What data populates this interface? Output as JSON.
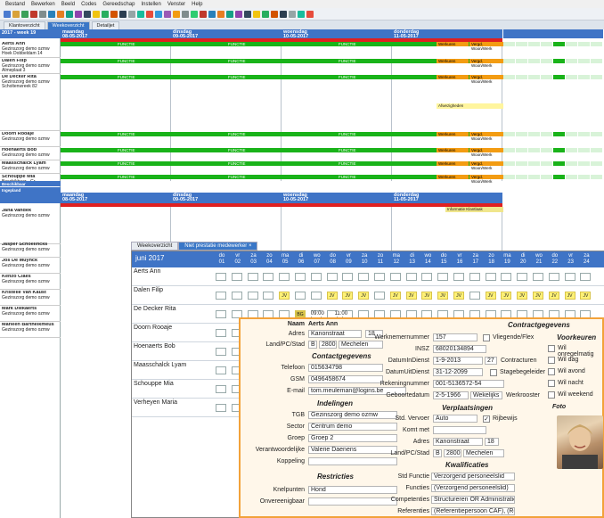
{
  "menu": [
    "Bestand",
    "Bewerken",
    "Beeld",
    "Codes",
    "Gereedschap",
    "Instellen",
    "Venster",
    "Help"
  ],
  "tabs": [
    "Klantoverzicht",
    "Weekoverzicht",
    "Detailjet"
  ],
  "week_label": "2017 - week 19",
  "days": [
    {
      "name": "maandag",
      "date": "08-05-2017"
    },
    {
      "name": "dinsdag",
      "date": "09-05-2017"
    },
    {
      "name": "woensdag",
      "date": "10-05-2017"
    },
    {
      "name": "donderdag",
      "date": "11-05-2017"
    }
  ],
  "people_top": [
    {
      "name": "Aerts Ann",
      "sub": "Gezinszorg demo ozmw",
      "extra": "Hoek Dobbeldam   14"
    },
    {
      "name": "Dalen Filip",
      "sub": "Gezinszorg demo ozmw",
      "extra": "Almeplaat   3"
    },
    {
      "name": "De Decker Rita",
      "sub": "Gezinszorg demo ozmw",
      "extra": "Scholtenwreek   82"
    }
  ],
  "people_mid": [
    {
      "name": "Doorn Rooaje",
      "sub": "Gezinszorg demo ozmw"
    },
    {
      "name": "Hoenaerts Bob",
      "sub": "Gezinszorg demo ozmw"
    },
    {
      "name": "Maasschalck Lyam",
      "sub": "Gezinszorg demo ozmw"
    },
    {
      "name": "Schouppe Mia",
      "sub": "Beschikbaar - Gr"
    }
  ],
  "people_bottom": [
    {
      "name": "Jana vandek",
      "sub": "Gezinszorg demo ozmw"
    },
    {
      "name": "Jasper Schoelincks",
      "sub": "Gezinszorg demo ozmw"
    },
    {
      "name": "Jos De Muynck",
      "sub": "Gezinszorg demo ozmw"
    },
    {
      "name": "Kenzo Claes",
      "sub": "Gezinszorg demo ozmw"
    },
    {
      "name": "Kristelle Van Kaust",
      "sub": "Gezinszorg demo ozmw"
    },
    {
      "name": "Mark Diekaerts",
      "sub": "Gezinszorg demo ozmw"
    },
    {
      "name": "Marleen Barthelkmeus",
      "sub": "Gezinszorg demo ozmw"
    }
  ],
  "popup": {
    "tabs": [
      "Weekoverzicht",
      "Niet prestatie medewerker"
    ],
    "close": "×",
    "month": "juni 2017",
    "days": [
      {
        "d": "do",
        "n": "01"
      },
      {
        "d": "vr",
        "n": "02"
      },
      {
        "d": "za",
        "n": "03"
      },
      {
        "d": "zo",
        "n": "04"
      },
      {
        "d": "ma",
        "n": "05"
      },
      {
        "d": "di",
        "n": "06"
      },
      {
        "d": "wo",
        "n": "07"
      },
      {
        "d": "do",
        "n": "08"
      },
      {
        "d": "vr",
        "n": "09"
      },
      {
        "d": "za",
        "n": "10"
      },
      {
        "d": "zo",
        "n": "11"
      },
      {
        "d": "ma",
        "n": "12"
      },
      {
        "d": "di",
        "n": "13"
      },
      {
        "d": "wo",
        "n": "14"
      },
      {
        "d": "do",
        "n": "15"
      },
      {
        "d": "vr",
        "n": "16"
      },
      {
        "d": "za",
        "n": "17"
      },
      {
        "d": "zo",
        "n": "18"
      },
      {
        "d": "ma",
        "n": "19"
      },
      {
        "d": "di",
        "n": "20"
      },
      {
        "d": "wo",
        "n": "21"
      },
      {
        "d": "do",
        "n": "22"
      },
      {
        "d": "vr",
        "n": "23"
      },
      {
        "d": "za",
        "n": "24"
      }
    ],
    "rows": [
      "Aerts Ann",
      "Dalen Filip",
      "De Decker Rita",
      "Doorn Rooaje",
      "Hoenaerts Bob",
      "Maasschalck Lyam",
      "Schouppe Mia",
      "Verheyen Maria"
    ],
    "jv": "JV",
    "bg": "BG",
    "bg_time1": "09:00",
    "bg_time2": "11:00"
  },
  "card": {
    "name_label": "Naam",
    "name": "Aerts Ann",
    "adres_label": "Adres",
    "adres": "Kanonstraat",
    "adres_nr": "18",
    "land_label": "Land/PC/Stad",
    "land": "B",
    "pc": "2800",
    "stad": "Mechelen",
    "contact_title": "Contactgegevens",
    "tel_label": "Telefoon",
    "tel": "015634798",
    "gsm_label": "GSM",
    "gsm": "0496458674",
    "email_label": "E-mail",
    "email": "tom.meuleman@logins.be",
    "indelingen_title": "Indelingen",
    "tgb_label": "TGB",
    "tgb": "Gezinszorg demo ozmw",
    "sector_label": "Sector",
    "sector": "Centrum demo",
    "groep_label": "Groep",
    "groep": "Groep 2",
    "verantw_label": "Verantwoordelijke",
    "verantw": "Valerie Daenens",
    "koppeling_label": "Koppeling",
    "restricties_title": "Restricties",
    "knelpunten_label": "Knelpunten",
    "knelpunten": "Hond",
    "onvereenig_label": "Onvereenigbaar",
    "wnr_label": "Werknemernummer",
    "wnr": "157",
    "vliegende_label": "Vliegende/Flex",
    "insz_label": "INSZ",
    "insz": "68020134894",
    "datin_label": "DatumInDienst",
    "datin": "1-9-2013",
    "datin_nr": "27",
    "contracturen_label": "Contracturen",
    "datuit_label": "DatumUitDienst",
    "datuit": "31-12-2099",
    "stagebegel_label": "Stagebegeleider",
    "rek_label": "Rekeningnummer",
    "rek": "001-5136572-54",
    "geboorte_label": "Geboortedatum",
    "geboorte": "2-5-1966",
    "wekelijks": "Wekelijks",
    "werkroost_label": "Werkrooster",
    "verplaatsingen_title": "Verplaatsingen",
    "stdverv_label": "Std. Vervoer",
    "stdverv": "Auto",
    "rijbewijs_label": "Rijbewijs",
    "komt_label": "Komt met",
    "adres2_label": "Adres",
    "adres2": "Kanonstraat",
    "adres2_nr": "18",
    "land2_label": "Land/PC/Stad",
    "land2": "B",
    "pc2": "2800",
    "stad2": "Mechelen",
    "kwalificaties_title": "Kwalificaties",
    "stdfunctie_label": "Std Functie",
    "stdfunctie": "Verzorgend personeelslid",
    "functies_label": "Functies",
    "functies": "(Verzorgend personeelslid)",
    "comp_label": "Competenties",
    "comp": "Structureren OR Administratie",
    "ref_label": "Referenties",
    "ref": "(Referentiepersoon CAF), (Ref",
    "contractgegevens_title": "Contractgegevens",
    "voorkeuren_title": "Voorkeuren",
    "vk1": "Wil onregelmatig",
    "vk2": "Wil dag",
    "vk3": "Wil avond",
    "vk4": "Wil nacht",
    "vk5": "Wil weekend",
    "foto_title": "Foto"
  },
  "sched_texts": {
    "verw": "VERW",
    "functie": "FUNCTIE",
    "werkuren": "Werkuren",
    "vergoeding": "Vergd. Woon/Werk",
    "afwezig": "Afwezigheden",
    "informatie": "Informatie Klantlaak",
    "frequentie": "Vrije Frequentie",
    "beschikbaar": "Beschikbaar",
    "ingepland": "Ingepland"
  },
  "colors": {
    "blue": "#3f74c6",
    "green": "#19b319",
    "red": "#e02020",
    "orange": "#f39c12",
    "yellow": "#fff176"
  }
}
